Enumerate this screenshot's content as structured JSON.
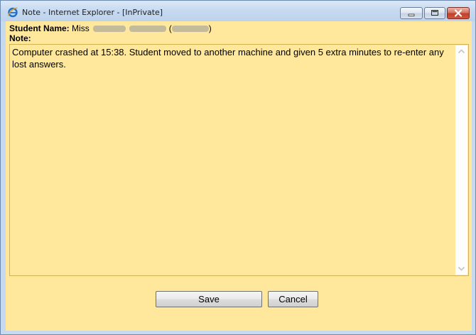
{
  "window": {
    "title": "Note - Internet Explorer - [InPrivate]",
    "icon": "internet-explorer-icon",
    "controls": [
      "minimize-icon",
      "maximize-icon",
      "close-icon"
    ]
  },
  "form": {
    "student_label": "Student Name:",
    "student_prefix": "Miss",
    "student_open_paren": "(",
    "student_close_paren": ")",
    "note_label": "Note:",
    "note_text": "Computer crashed at 15:38. Student moved to another machine and given 5 extra minutes to re-enter any lost answers."
  },
  "buttons": {
    "save": "Save",
    "cancel": "Cancel"
  },
  "colors": {
    "form_background": "#ffe79b",
    "title_bar": "#c6d9f0",
    "close_button": "#c2402a"
  }
}
